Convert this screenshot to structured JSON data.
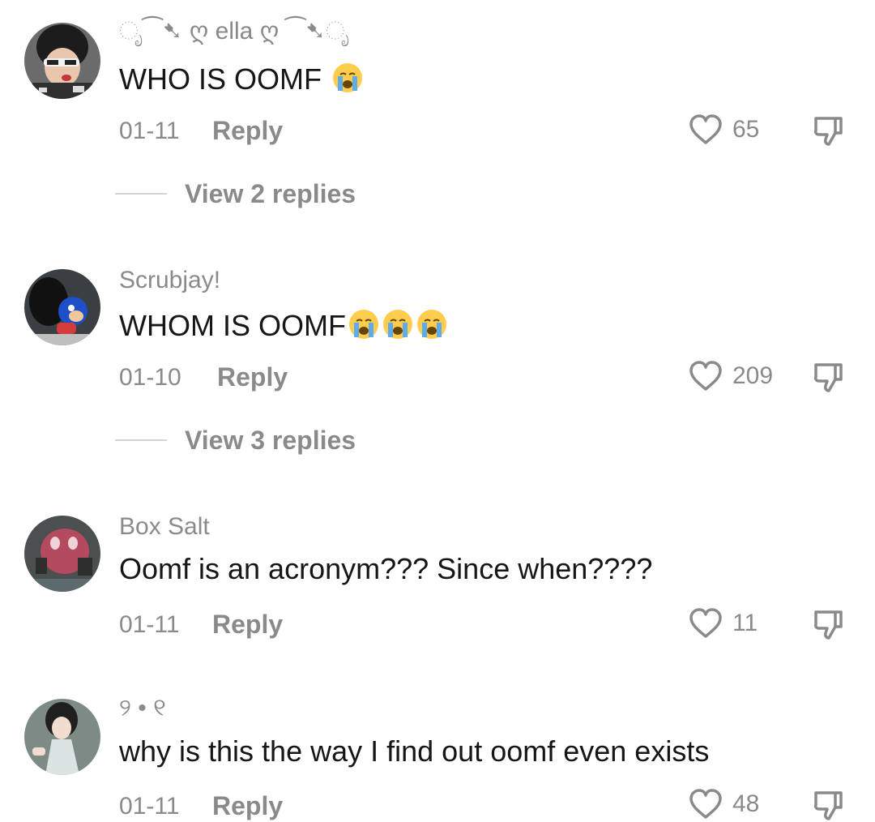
{
  "comments": [
    {
      "username": "ೃ⁀➷ ღ ella ღ ⁀➷ೃ",
      "text": "WHO IS OOMF",
      "emoji_count": 1,
      "date": "01-11",
      "reply_label": "Reply",
      "likes": "65",
      "view_replies": "View 2 replies"
    },
    {
      "username": "Scrubjay!",
      "text": "WHOM IS OOMF",
      "emoji_count": 3,
      "date": "01-10",
      "reply_label": "Reply",
      "likes": "209",
      "view_replies": "View 3 replies"
    },
    {
      "username": "Box Salt",
      "text": "Oomf is an acronym??? Since when????",
      "emoji_count": 0,
      "date": "01-11",
      "reply_label": "Reply",
      "likes": "11"
    },
    {
      "username": "୨ • ୧",
      "text": "why is this the way I find out oomf even exists",
      "emoji_count": 0,
      "date": "01-11",
      "reply_label": "Reply",
      "likes": "48"
    }
  ],
  "icons": {
    "like": "heart-outline-icon",
    "dislike": "thumbs-down-icon",
    "emoji": "loudly-crying-face-emoji"
  },
  "colors": {
    "text_primary": "#161616",
    "text_secondary": "#8a8a8a",
    "divider": "#d4d4d4"
  }
}
